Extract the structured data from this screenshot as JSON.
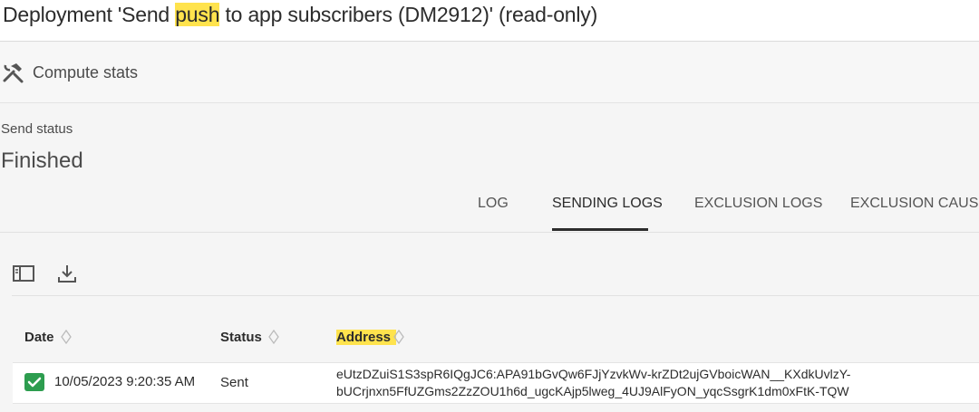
{
  "window": {
    "title_prefix": "Deployment 'Send ",
    "title_highlight": "push",
    "title_suffix": " to app subscribers (DM2912)' (read-only)"
  },
  "toolbar": {
    "compute_label": "Compute stats",
    "compute_icon": "hammer-wrench-icon"
  },
  "status": {
    "label": "Send status",
    "value": "Finished"
  },
  "tabs": [
    {
      "label": "LOG",
      "active": false
    },
    {
      "label": "SENDING LOGS",
      "active": true
    },
    {
      "label": "EXCLUSION LOGS",
      "active": false
    },
    {
      "label": "EXCLUSION CAUSES",
      "active": false
    }
  ],
  "list_toolbar": {
    "panel_icon": "panel-toggle-icon",
    "download_icon": "download-icon"
  },
  "table": {
    "columns": [
      {
        "label": "Date",
        "sortable": true
      },
      {
        "label": "Status",
        "sortable": true
      },
      {
        "label": "Address",
        "sortable": true,
        "highlighted": true
      }
    ],
    "rows": [
      {
        "status_icon": "green-check-icon",
        "date": "10/05/2023 9:20:35 AM",
        "status": "Sent",
        "address_line1": "eUtzDZuiS1S3spR6IQgJC6:APA91bGvQw6FJjYzvkWv-krZDt2ujGVboicWAN__KXdkUvlzY-",
        "address_line2": "bUCrjnxn5FfUZGms2ZzZOU1h6d_ugcKAjp5lweg_4UJ9AlFyON_yqcSsgrK1dm0xFtK-TQW"
      }
    ]
  },
  "colors": {
    "highlight": "#ffe34d",
    "success": "#2d9d4f",
    "text": "#2c2c2c"
  }
}
